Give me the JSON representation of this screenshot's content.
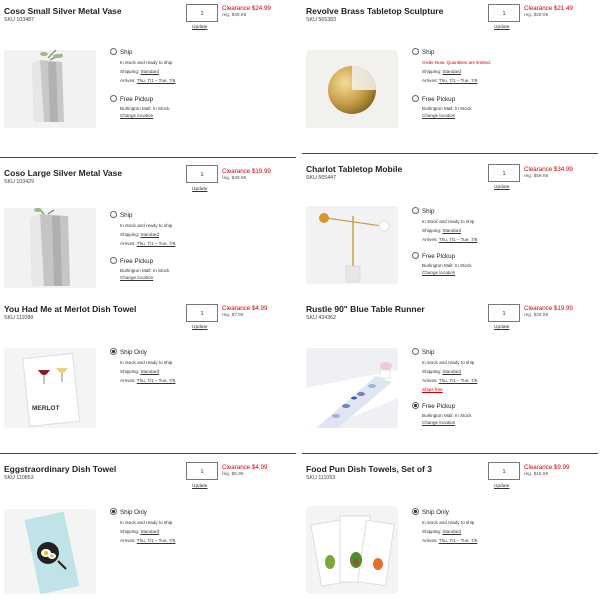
{
  "colors": {
    "clearance": "#d00000"
  },
  "products": [
    {
      "title": "Coso Small Silver Metal Vase",
      "sku": "SKU 103487",
      "qty": "1",
      "price": "Clearance $24.99",
      "reg": "reg. $39.95",
      "update": "Update",
      "ship": {
        "label": "Ship",
        "selected": false,
        "status": "In stock and ready to ship",
        "shipping": "Shipping:",
        "shipping_link": "Standard",
        "arrives": "Arrives:",
        "arrives_link": "Thu, 7/1 – Tue, 7/6"
      },
      "pickup": {
        "label": "Free Pickup",
        "selected": false,
        "store": "Burlington Mall: In Stock",
        "change": "Change location"
      }
    },
    {
      "title": "Revolve Brass Tabletop Sculpture",
      "sku": "SKU 565383",
      "qty": "1",
      "price": "Clearance $21.49",
      "reg": "reg. $29.95",
      "update": "Update",
      "ship": {
        "label": "Ship",
        "selected": false,
        "status": "Order Now. Quantities are limited.",
        "status_red": true,
        "shipping": "Shipping:",
        "shipping_link": "Standard",
        "arrives": "Arrives:",
        "arrives_link": "Thu, 7/1 – Tue, 7/6"
      },
      "pickup": {
        "label": "Free Pickup",
        "selected": false,
        "store": "Burlington Mall: In Stock",
        "change": "Change location"
      }
    },
    {
      "title": "Coso Large Silver Metal Vase",
      "sku": "SKU 103429",
      "qty": "1",
      "price": "Clearance $19.99",
      "reg": "reg. $49.95",
      "update": "Update",
      "ship": {
        "label": "Ship",
        "selected": false,
        "status": "In stock and ready to ship",
        "shipping": "Shipping:",
        "shipping_link": "Standard",
        "arrives": "Arrives:",
        "arrives_link": "Thu, 7/1 – Tue, 7/6"
      },
      "pickup": {
        "label": "Free Pickup",
        "selected": false,
        "store": "Burlington Mall: In Stock",
        "change": "Change location"
      }
    },
    {
      "title": "Charlot Tabletop Mobile",
      "sku": "SKU 565447",
      "qty": "1",
      "price": "Clearance $34.99",
      "reg": "reg. $59.95",
      "update": "Update",
      "ship": {
        "label": "Ship",
        "selected": false,
        "status": "In stock and ready to ship",
        "shipping": "Shipping:",
        "shipping_link": "Standard",
        "arrives": "Arrives:",
        "arrives_link": "Thu, 7/1 – Tue, 7/6"
      },
      "pickup": {
        "label": "Free Pickup",
        "selected": false,
        "store": "Burlington Mall: In Stock",
        "change": "Change location"
      }
    },
    {
      "title": "You Had Me at Merlot Dish Towel",
      "sku": "SKU 111088",
      "qty": "1",
      "price": "Clearance $4.99",
      "reg": "reg. $7.95",
      "update": "Update",
      "ship": {
        "label": "Ship Only",
        "selected": true,
        "status": "In stock and ready to ship",
        "shipping": "Shipping:",
        "shipping_link": "Standard",
        "arrives": "Arrives:",
        "arrives_link": "Thu, 7/1 – Tue, 7/6"
      },
      "towel_text": "MERLOT"
    },
    {
      "title": "Rustle 90\" Blue Table Runner",
      "sku": "SKU 434362",
      "qty": "1",
      "price": "Clearance $19.99",
      "reg": "reg. $29.95",
      "update": "Update",
      "ship": {
        "label": "Ship",
        "selected": false,
        "status": "In stock and ready to ship",
        "shipping": "Shipping:",
        "shipping_link": "Standard",
        "arrives": "Arrives:",
        "arrives_link": "Thu, 7/1 – Tue, 7/6",
        "extra_link": "Ships free"
      },
      "pickup": {
        "label": "Free Pickup",
        "selected": true,
        "store": "Burlington Mall: In Stock",
        "change": "Change location"
      }
    },
    {
      "title": "Eggstraordinary Dish Towel",
      "sku": "SKU 110853",
      "qty": "1",
      "price": "Clearance $4.99",
      "reg": "reg. $6.95",
      "update": "Update",
      "ship": {
        "label": "Ship Only",
        "selected": true,
        "status": "In stock and ready to ship",
        "shipping": "Shipping:",
        "shipping_link": "Standard",
        "arrives": "Arrives:",
        "arrives_link": "Thu, 7/1 – Tue, 7/6"
      }
    },
    {
      "title": "Food Pun Dish Towels, Set of 3",
      "sku": "SKU 111053",
      "qty": "1",
      "price": "Clearance $9.99",
      "reg": "reg. $16.95",
      "update": "Update",
      "ship": {
        "label": "Ship Only",
        "selected": true,
        "status": "In stock and ready to ship",
        "shipping": "Shipping:",
        "shipping_link": "Standard",
        "arrives": "Arrives:",
        "arrives_link": "Thu, 7/1 – Tue, 7/6"
      }
    }
  ]
}
